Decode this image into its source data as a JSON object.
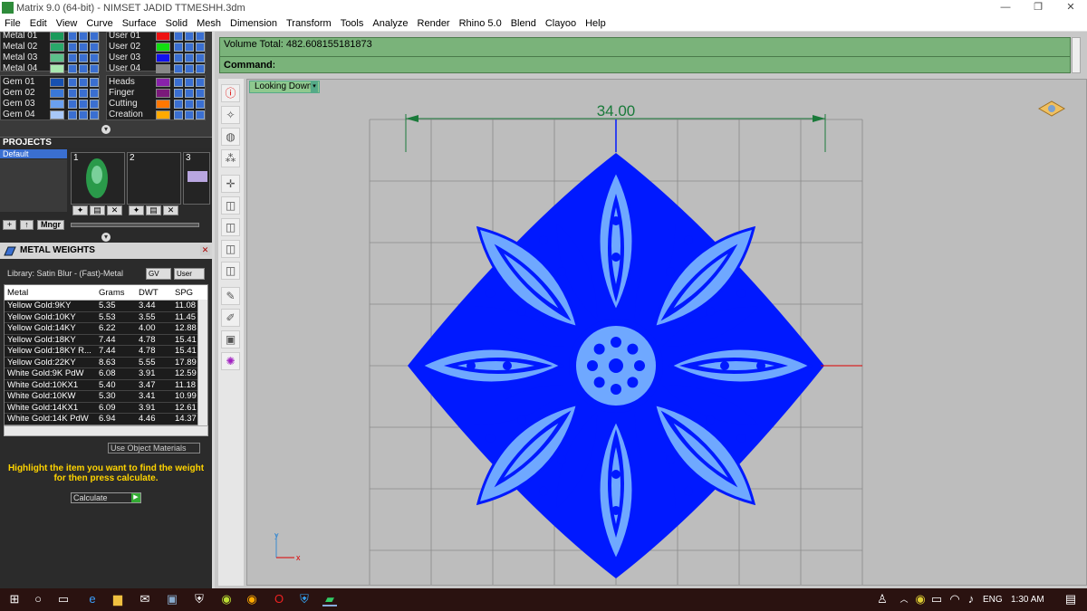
{
  "window": {
    "title": "Matrix 9.0 (64-bit) - NIMSET JADID TTMESHH.3dm",
    "min": "—",
    "max": "❐",
    "close": "✕"
  },
  "menu": [
    "File",
    "Edit",
    "View",
    "Curve",
    "Surface",
    "Solid",
    "Mesh",
    "Dimension",
    "Transform",
    "Tools",
    "Analyze",
    "Render",
    "Rhino 5.0",
    "Blend",
    "Clayoo",
    "Help"
  ],
  "layers": {
    "metals": [
      {
        "name": "Metal 01",
        "color": "#1a9a5a"
      },
      {
        "name": "Metal 02",
        "color": "#2aa86a"
      },
      {
        "name": "Metal 03",
        "color": "#5cc08a"
      },
      {
        "name": "Metal 04",
        "color": "#a8e8b0"
      }
    ],
    "users": [
      {
        "name": "User 01",
        "color": "#ee1111"
      },
      {
        "name": "User 02",
        "color": "#11dd11"
      },
      {
        "name": "User 03",
        "color": "#1111ee"
      },
      {
        "name": "User 04",
        "color": "#888888"
      }
    ],
    "gems": [
      {
        "name": "Gem 01",
        "color": "#1650b0"
      },
      {
        "name": "Gem 02",
        "color": "#3a78d8"
      },
      {
        "name": "Gem 03",
        "color": "#6aa0f0"
      },
      {
        "name": "Gem 04",
        "color": "#a8c8f8"
      }
    ],
    "others": [
      {
        "name": "Heads",
        "color": "#8822aa"
      },
      {
        "name": "Finger",
        "color": "#7a1a7a"
      },
      {
        "name": "Cutting",
        "color": "#ff7700"
      },
      {
        "name": "Creation",
        "color": "#ffaa00"
      }
    ]
  },
  "projects": {
    "header": "PROJECTS",
    "default_label": "Default",
    "thumbs": [
      "1",
      "2",
      "3"
    ],
    "mngr": "Mngr"
  },
  "metal_weights": {
    "header": "METAL WEIGHTS",
    "library": "Library: Satin Blur - (Fast)-Metal",
    "gv": "GV",
    "user": "User",
    "columns": [
      "Metal",
      "Grams",
      "DWT",
      "SPG"
    ],
    "rows": [
      [
        "Yellow Gold:9KY",
        "5.35",
        "3.44",
        "11.08"
      ],
      [
        "Yellow Gold:10KY",
        "5.53",
        "3.55",
        "11.45"
      ],
      [
        "Yellow Gold:14KY",
        "6.22",
        "4.00",
        "12.88"
      ],
      [
        "Yellow Gold:18KY",
        "7.44",
        "4.78",
        "15.41"
      ],
      [
        "Yellow Gold:18KY R...",
        "7.44",
        "4.78",
        "15.41"
      ],
      [
        "Yellow Gold:22KY",
        "8.63",
        "5.55",
        "17.89"
      ],
      [
        "White Gold:9K PdW",
        "6.08",
        "3.91",
        "12.59"
      ],
      [
        "White Gold:10KX1",
        "5.40",
        "3.47",
        "11.18"
      ],
      [
        "White Gold:10KW",
        "5.30",
        "3.41",
        "10.99"
      ],
      [
        "White Gold:14KX1",
        "6.09",
        "3.91",
        "12.61"
      ],
      [
        "White Gold:14K PdW",
        "6.94",
        "4.46",
        "14.37"
      ]
    ],
    "use_object_materials": "Use Object Materials",
    "hint": "Highlight the item you want to find the weight for then press calculate.",
    "calculate": "Calculate"
  },
  "command": {
    "volume": "Volume Total: 482.608155181873",
    "label": "Command:"
  },
  "viewport": {
    "label": "Looking Down",
    "dimension": "34.00",
    "axis_y": "y",
    "axis_x": "x"
  },
  "colors": {
    "shape_dark": "#0019ff",
    "shape_light": "#6fa8ff",
    "grid": "#8a8a8a"
  },
  "toolbar_icons": [
    "info-icon",
    "vertex-icon",
    "sphere-icon",
    "nodes-icon",
    "axis-icon",
    "box-icon",
    "box-icon",
    "box-icon",
    "box-icon",
    "pen-icon",
    "brush-icon",
    "frame-icon",
    "gem-icon"
  ],
  "taskbar": {
    "lang": "ENG",
    "time": "1:30 AM"
  }
}
